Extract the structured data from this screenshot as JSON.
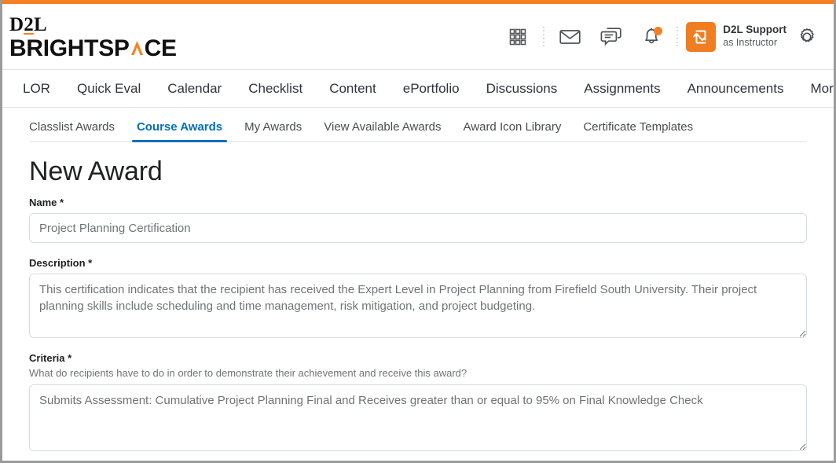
{
  "brand": {
    "d2l_pre": "D",
    "d2l_two": "2",
    "d2l_post": "L",
    "name_pre": "BRIGHTSP",
    "name_post": "CE",
    "logo_alt": "D2L Brightspace"
  },
  "header": {
    "icons": [
      {
        "name": "waffle-grid-icon",
        "label": "Course Selector"
      },
      {
        "name": "email-icon",
        "label": "Email"
      },
      {
        "name": "chat-icon",
        "label": "Messages"
      },
      {
        "name": "bell-icon",
        "label": "Notifications"
      }
    ],
    "notification_badge": true,
    "profile": {
      "name": "D2L Support",
      "role": "as Instructor",
      "avatar_icon": "swap-arrows-icon"
    },
    "settings_icon": "gear-icon"
  },
  "nav": {
    "items": [
      {
        "label": "LOR"
      },
      {
        "label": "Quick Eval"
      },
      {
        "label": "Calendar"
      },
      {
        "label": "Checklist"
      },
      {
        "label": "Content"
      },
      {
        "label": "ePortfolio"
      },
      {
        "label": "Discussions"
      },
      {
        "label": "Assignments"
      },
      {
        "label": "Announcements"
      }
    ],
    "more_label": "More"
  },
  "subnav": {
    "tabs": [
      {
        "label": "Classlist Awards",
        "active": false
      },
      {
        "label": "Course Awards",
        "active": true
      },
      {
        "label": "My Awards",
        "active": false
      },
      {
        "label": "View Available Awards",
        "active": false
      },
      {
        "label": "Award Icon Library",
        "active": false
      },
      {
        "label": "Certificate Templates",
        "active": false
      }
    ],
    "active_color": "#006fbf"
  },
  "main": {
    "title": "New Award",
    "fields": {
      "name": {
        "label": "Name",
        "required_mark": "*",
        "value": "Project Planning Certification",
        "placeholder": ""
      },
      "description": {
        "label": "Description",
        "required_mark": "*",
        "value": "This certification indicates that the recipient has received the Expert Level in Project Planning from Firefield South University. Their project planning skills include scheduling and time management, risk mitigation, and project budgeting.",
        "placeholder": ""
      },
      "criteria": {
        "label": "Criteria",
        "required_mark": "*",
        "help": "What do recipients have to do in order to demonstrate their achievement and receive this award?",
        "value": "Submits Assessment: Cumulative Project Planning Final and Receives greater than or equal to 95% on Final Knowledge Check",
        "placeholder": ""
      }
    }
  },
  "colors": {
    "brand_orange": "#f58024",
    "accent_blue": "#006fbf",
    "text_dark": "#202122",
    "text_muted": "#6e7477"
  }
}
